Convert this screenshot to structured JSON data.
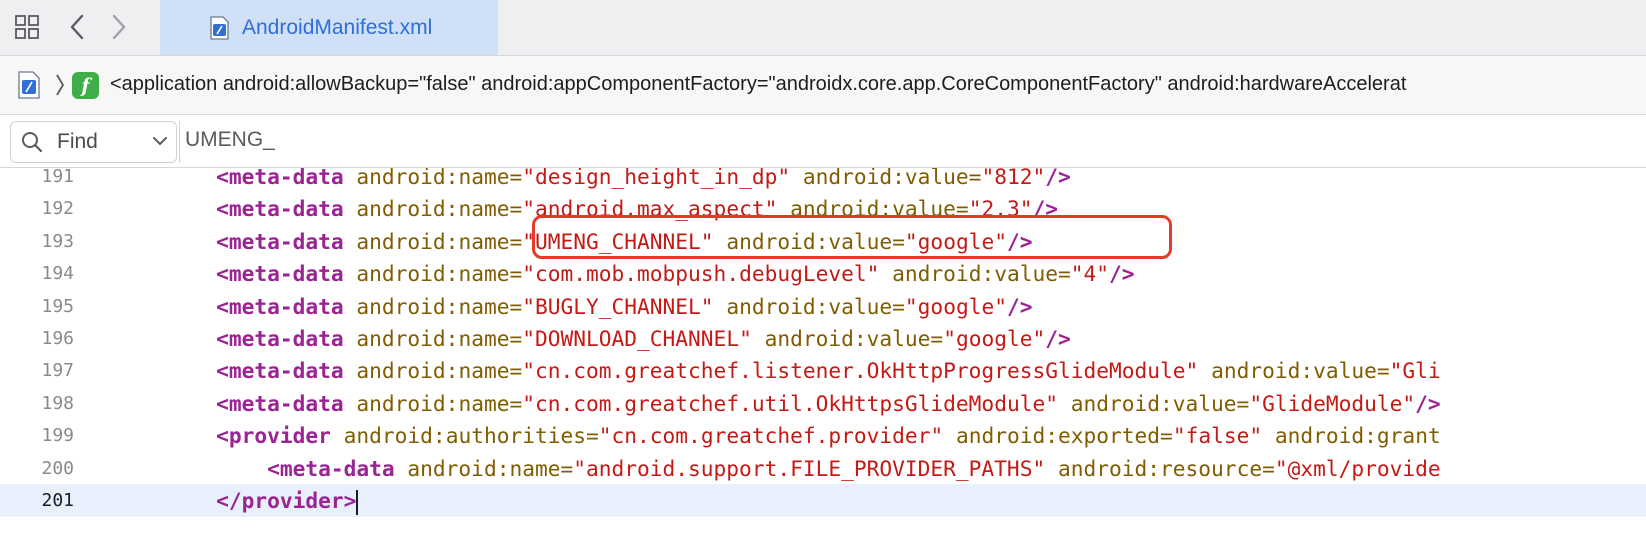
{
  "tab": {
    "filename": "AndroidManifest.xml"
  },
  "jumpbar": {
    "path_text": "<application android:allowBackup=\"false\" android:appComponentFactory=\"androidx.core.app.CoreComponentFactory\" android:hardwareAccelerat"
  },
  "find": {
    "mode_label": "Find",
    "query": "UMENG_"
  },
  "colors": {
    "tag": "#9b2393",
    "attribute": "#805d00",
    "string": "#c41a16",
    "highlight": "#e8382a",
    "tab_active": "#cfe0f7",
    "current_line": "#e8f0fd"
  },
  "lines": [
    {
      "num": "191",
      "indent": "        ",
      "tag": "<meta-data",
      "attrs": [
        {
          "lead": " ",
          "name": "android:name=",
          "value": "\"design_height_in_dp\""
        },
        {
          "lead": " ",
          "name": "android:value=",
          "value": "\"812\""
        }
      ],
      "close": "/>"
    },
    {
      "num": "192",
      "indent": "        ",
      "tag": "<meta-data",
      "attrs": [
        {
          "lead": " ",
          "name": "android:name=",
          "value": "\"android.max_aspect\""
        },
        {
          "lead": " ",
          "name": "android:value=",
          "value": "\"2.3\""
        }
      ],
      "close": "/>"
    },
    {
      "num": "193",
      "indent": "        ",
      "tag": "<meta-data",
      "attrs": [
        {
          "lead": " ",
          "name": "android:name=",
          "value": "\"UMENG_CHANNEL\""
        },
        {
          "lead": " ",
          "name": "android:value=",
          "value": "\"google\""
        }
      ],
      "close": "/>"
    },
    {
      "num": "194",
      "indent": "        ",
      "tag": "<meta-data",
      "attrs": [
        {
          "lead": " ",
          "name": "android:name=",
          "value": "\"com.mob.mobpush.debugLevel\""
        },
        {
          "lead": " ",
          "name": "android:value=",
          "value": "\"4\""
        }
      ],
      "close": "/>"
    },
    {
      "num": "195",
      "indent": "        ",
      "tag": "<meta-data",
      "attrs": [
        {
          "lead": " ",
          "name": "android:name=",
          "value": "\"BUGLY_CHANNEL\""
        },
        {
          "lead": " ",
          "name": "android:value=",
          "value": "\"google\""
        }
      ],
      "close": "/>"
    },
    {
      "num": "196",
      "indent": "        ",
      "tag": "<meta-data",
      "attrs": [
        {
          "lead": " ",
          "name": "android:name=",
          "value": "\"DOWNLOAD_CHANNEL\""
        },
        {
          "lead": " ",
          "name": "android:value=",
          "value": "\"google\""
        }
      ],
      "close": "/>"
    },
    {
      "num": "197",
      "indent": "        ",
      "tag": "<meta-data",
      "attrs": [
        {
          "lead": " ",
          "name": "android:name=",
          "value": "\"cn.com.greatchef.listener.OkHttpProgressGlideModule\""
        },
        {
          "lead": " ",
          "name": "android:value=",
          "value": "\"Gli"
        }
      ],
      "close": ""
    },
    {
      "num": "198",
      "indent": "        ",
      "tag": "<meta-data",
      "attrs": [
        {
          "lead": " ",
          "name": "android:name=",
          "value": "\"cn.com.greatchef.util.OkHttpsGlideModule\""
        },
        {
          "lead": " ",
          "name": "android:value=",
          "value": "\"GlideModule\""
        }
      ],
      "close": "/>"
    },
    {
      "num": "199",
      "indent": "        ",
      "tag": "<provider",
      "attrs": [
        {
          "lead": " ",
          "name": "android:authorities=",
          "value": "\"cn.com.greatchef.provider\""
        },
        {
          "lead": " ",
          "name": "android:exported=",
          "value": "\"false\""
        },
        {
          "lead": " ",
          "name": "android:grant",
          "value": ""
        }
      ],
      "close": ""
    },
    {
      "num": "200",
      "indent": "            ",
      "tag": "<meta-data",
      "attrs": [
        {
          "lead": " ",
          "name": "android:name=",
          "value": "\"android.support.FILE_PROVIDER_PATHS\""
        },
        {
          "lead": " ",
          "name": "android:resource=",
          "value": "\"@xml/provide"
        }
      ],
      "close": ""
    },
    {
      "num": "201",
      "indent": "        ",
      "tag": "</provider>",
      "attrs": [],
      "close": "",
      "current": true
    }
  ]
}
